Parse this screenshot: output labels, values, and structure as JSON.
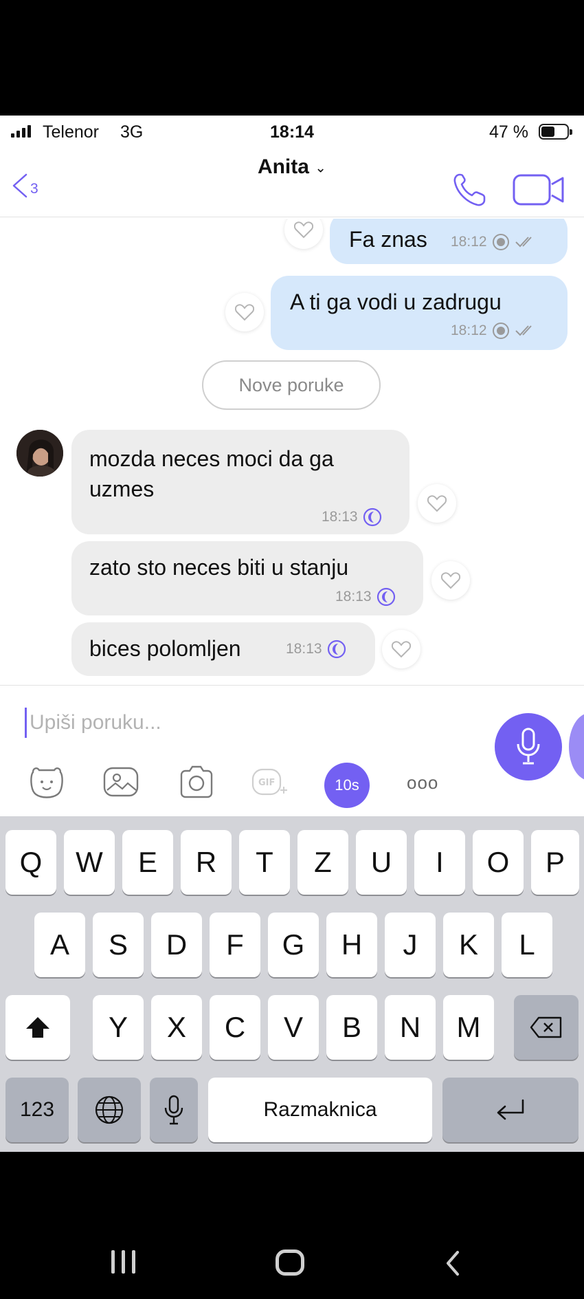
{
  "status_bar": {
    "carrier": "Telenor",
    "network": "3G",
    "time": "18:14",
    "battery": "47 %"
  },
  "header": {
    "back_count": "3",
    "contact_name": "Anita",
    "chevron": "⌄"
  },
  "messages": [
    {
      "direction": "out",
      "text": "Fa znas",
      "time": "18:12"
    },
    {
      "direction": "out",
      "text": "A ti ga vodi u zadrugu",
      "time": "18:12"
    },
    {
      "direction": "in",
      "text": "mozda neces moci da ga uzmes",
      "time": "18:13"
    },
    {
      "direction": "in",
      "text": "zato sto neces biti u stanju",
      "time": "18:13"
    },
    {
      "direction": "in",
      "text": "bices polomljen",
      "time": "18:13"
    }
  ],
  "divider": {
    "label": "Nove poruke"
  },
  "composer": {
    "placeholder": "Upiši poruku...",
    "timer_label": "10s",
    "more": "ooo"
  },
  "keyboard": {
    "row1": [
      "Q",
      "W",
      "E",
      "R",
      "T",
      "Z",
      "U",
      "I",
      "O",
      "P"
    ],
    "row2": [
      "A",
      "S",
      "D",
      "F",
      "G",
      "H",
      "J",
      "K",
      "L"
    ],
    "row3": [
      "Y",
      "X",
      "C",
      "V",
      "B",
      "N",
      "M"
    ],
    "numbers_label": "123",
    "space_label": "Razmaknica"
  },
  "colors": {
    "accent": "#7360f2",
    "outgoing_bubble": "#d6e8fb",
    "incoming_bubble": "#ededed"
  }
}
